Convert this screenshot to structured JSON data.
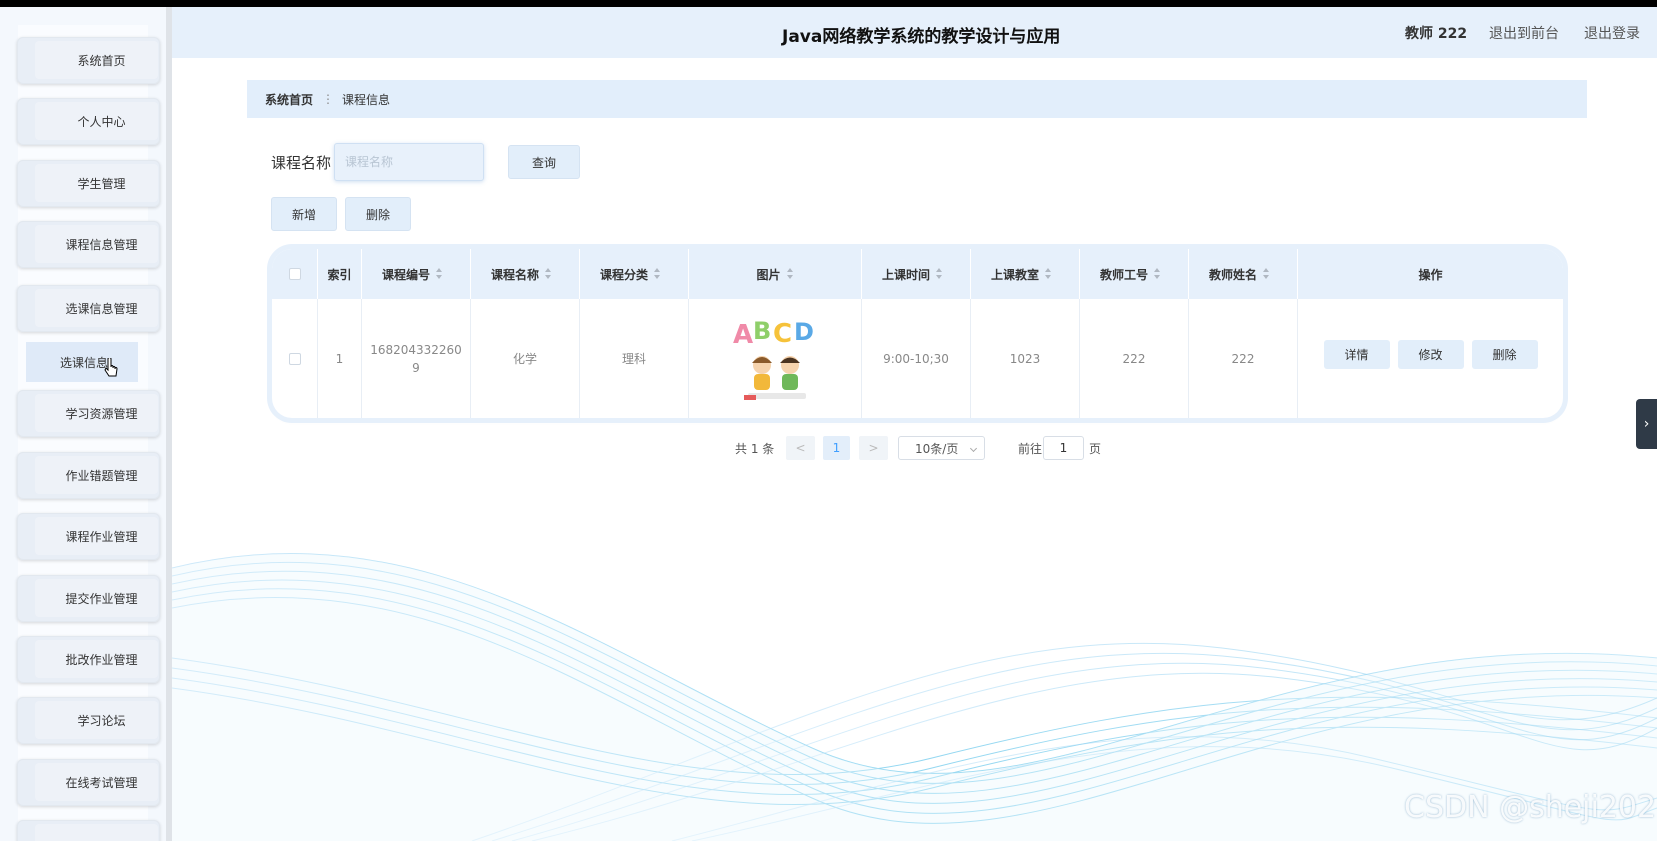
{
  "header": {
    "title": "Java网络教学系统的教学设计与应用",
    "user": "教师 222",
    "link_front": "退出到前台",
    "link_logout": "退出登录"
  },
  "sidebar": {
    "items": [
      {
        "label": "系统首页"
      },
      {
        "label": "个人中心"
      },
      {
        "label": "学生管理"
      },
      {
        "label": "课程信息管理"
      },
      {
        "label": "选课信息管理"
      },
      {
        "label": "学习资源管理"
      },
      {
        "label": "作业错题管理"
      },
      {
        "label": "课程作业管理"
      },
      {
        "label": "提交作业管理"
      },
      {
        "label": "批改作业管理"
      },
      {
        "label": "学习论坛"
      },
      {
        "label": "在线考试管理"
      }
    ],
    "submenu": {
      "label": "选课信息"
    }
  },
  "breadcrumb": {
    "home": "系统首页",
    "separator": "⋮",
    "current": "课程信息"
  },
  "search": {
    "label": "课程名称",
    "placeholder": "课程名称",
    "button": "查询"
  },
  "actions": {
    "add": "新增",
    "delete": "删除"
  },
  "table": {
    "columns": [
      "索引",
      "课程编号",
      "课程名称",
      "课程分类",
      "图片",
      "上课时间",
      "上课教室",
      "教师工号",
      "教师姓名",
      "操作"
    ],
    "rows": [
      {
        "index": "1",
        "course_no_line1": "168204332260",
        "course_no_line2": "9",
        "course_name": "化学",
        "category": "理科",
        "image_text": "ABCD",
        "time": "9:00-10;30",
        "room": "1023",
        "teacher_no": "222",
        "teacher_name": "222",
        "ops": {
          "detail": "详情",
          "edit": "修改",
          "delete": "删除"
        }
      }
    ]
  },
  "pagination": {
    "total": "共 1 条",
    "prev": "<",
    "page": "1",
    "next": ">",
    "page_size": "10条/页",
    "goto_prefix": "前往",
    "goto_value": "1",
    "goto_suffix": "页"
  },
  "watermark": "CSDN @sheji202",
  "colors": {
    "header_bg": "#e6f0fb",
    "button_bg": "#e2eefa",
    "accent": "#409eff"
  }
}
